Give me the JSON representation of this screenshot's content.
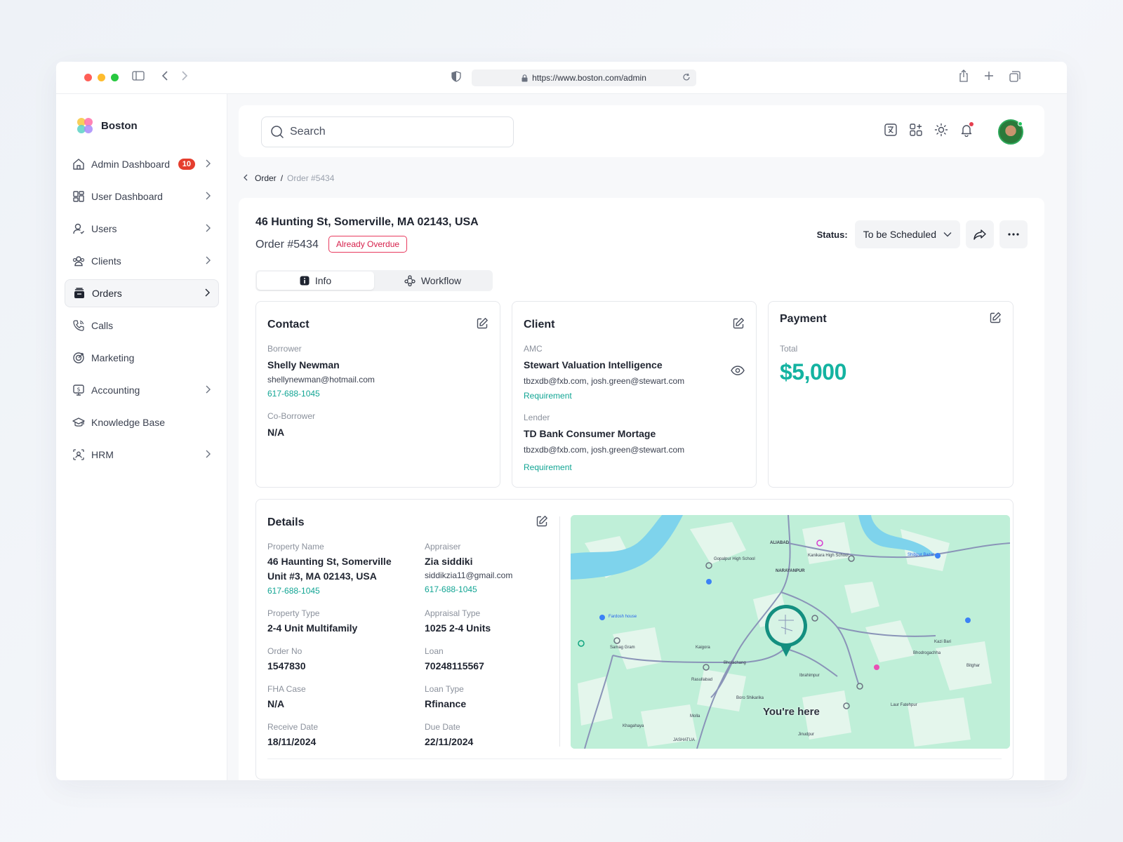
{
  "browser": {
    "url": "https://www.boston.com/admin"
  },
  "sidebar": {
    "brand": "Boston",
    "items": [
      {
        "label": "Admin Dashboard",
        "badge": "10",
        "icon": "home-icon"
      },
      {
        "label": "User Dashboard",
        "icon": "grid-icon"
      },
      {
        "label": "Users",
        "icon": "user-icon"
      },
      {
        "label": "Clients",
        "icon": "clients-icon"
      },
      {
        "label": "Orders",
        "icon": "orders-icon",
        "active": true
      },
      {
        "label": "Calls",
        "icon": "phone-icon"
      },
      {
        "label": "Marketing",
        "icon": "target-icon"
      },
      {
        "label": "Accounting",
        "icon": "accounting-icon"
      },
      {
        "label": "Knowledge Base",
        "icon": "graduation-cap-icon"
      },
      {
        "label": "HRM",
        "icon": "hrm-icon"
      }
    ]
  },
  "topbar": {
    "search_placeholder": "Search"
  },
  "breadcrumb": {
    "parent": "Order",
    "separator": "/",
    "current": "Order #5434"
  },
  "order": {
    "address": "46 Hunting St, Somerville, MA 02143, USA",
    "number": "Order #5434",
    "overdue_badge": "Already Overdue",
    "status_label": "Status:",
    "status_value": "To be Scheduled"
  },
  "tabs": [
    {
      "label": "Info",
      "active": true
    },
    {
      "label": "Workflow"
    }
  ],
  "contact": {
    "title": "Contact",
    "borrower_label": "Borrower",
    "borrower_name": "Shelly Newman",
    "borrower_email": "shellynewman@hotmail.com",
    "borrower_phone": "617-688-1045",
    "coborrower_label": "Co-Borrower",
    "coborrower_value": "N/A"
  },
  "client": {
    "title": "Client",
    "amc_label": "AMC",
    "amc_name": "Stewart Valuation Intelligence",
    "amc_emails": "tbzxdb@fxb.com, josh.green@stewart.com",
    "amc_link": "Requirement",
    "lender_label": "Lender",
    "lender_name": "TD Bank Consumer Mortage",
    "lender_emails": "tbzxdb@fxb.com, josh.green@stewart.com",
    "lender_link": "Requirement"
  },
  "payment": {
    "title": "Payment",
    "total_label": "Total",
    "total_value": "$5,000"
  },
  "details": {
    "title": "Details",
    "property_name_label": "Property Name",
    "property_name_line1": "46 Haunting St, Somerville",
    "property_name_line2": "Unit #3, MA 02143, USA",
    "property_phone": "617-688-1045",
    "appraiser_label": "Appraiser",
    "appraiser_name": "Zia siddiki",
    "appraiser_email": "siddikzia11@gmail.com",
    "appraiser_phone": "617-688-1045",
    "property_type_label": "Property Type",
    "property_type_value": "2-4 Unit Multifamily",
    "appraisal_type_label": "Appraisal Type",
    "appraisal_type_value": "1025 2-4 Units",
    "order_no_label": "Order No",
    "order_no_value": "1547830",
    "loan_label": "Loan",
    "loan_value": "70248115567",
    "fha_label": "FHA Case",
    "fha_value": "N/A",
    "loan_type_label": "Loan Type",
    "loan_type_value": "Rfinance",
    "receive_date_label": "Receive Date",
    "receive_date_value": "18/11/2024",
    "due_date_label": "Due Date",
    "due_date_value": "22/11/2024"
  },
  "map": {
    "you_are_here": "You're here",
    "places": [
      "ALIABAD",
      "Gopalpur High School",
      "Kanikara High School",
      "Shibpur Bazar",
      "NARAYANPUR",
      "Fardosh house",
      "Samag Gram",
      "Kaigora",
      "Bholachang",
      "Kazi Bari",
      "Bhodrogachha",
      "Bitghar",
      "Rasullabad",
      "Ibrahimpur",
      "Boro Shikarika",
      "Laur Fatehpur",
      "Molla",
      "Khagahaya",
      "Jinudpur",
      "JASHATUA"
    ],
    "colors": {
      "land": "#bfefd8",
      "water": "#7ed3ec",
      "road": "#8a94b8",
      "pin": "#138f80"
    }
  },
  "colors": {
    "accent_teal": "#14b3a1",
    "overdue_red": "#e83b5f",
    "badge_red": "#e53e2e"
  }
}
